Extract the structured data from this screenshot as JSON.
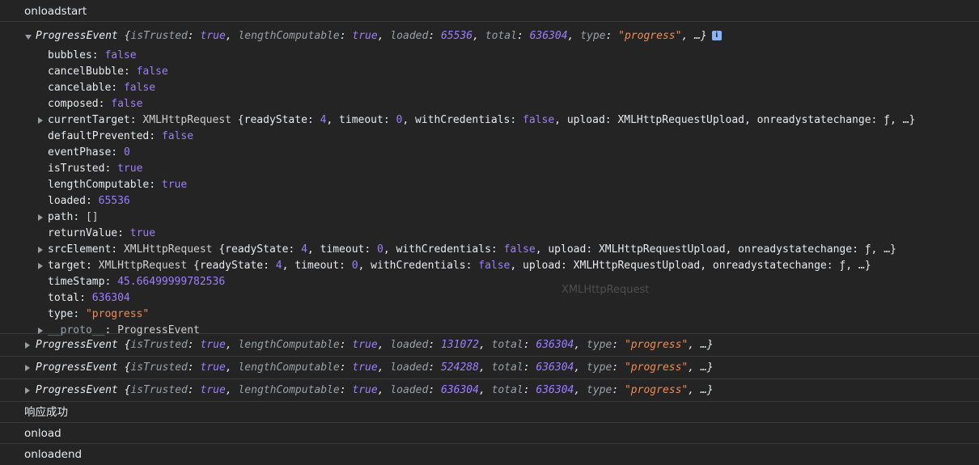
{
  "lines": {
    "onloadstart": "onloadstart",
    "success": "响应成功",
    "onload": "onload",
    "onloadend": "onloadend"
  },
  "expanded_event": {
    "class_name": "ProgressEvent",
    "loaded": "65536",
    "total": "636304",
    "type": "\"progress\"",
    "ellipsis": "…",
    "info_icon_label": "i"
  },
  "properties": [
    {
      "key": "bubbles",
      "value": "false",
      "kind": "b"
    },
    {
      "key": "cancelBubble",
      "value": "false",
      "kind": "b"
    },
    {
      "key": "cancelable",
      "value": "false",
      "kind": "b"
    },
    {
      "key": "composed",
      "value": "false",
      "kind": "b"
    },
    {
      "key": "currentTarget",
      "expandable": true,
      "obj": "XMLHttpRequest",
      "readyState": "4",
      "timeout": "0",
      "withCredentials": "false",
      "upload": "XMLHttpRequestUpload"
    },
    {
      "key": "defaultPrevented",
      "value": "false",
      "kind": "b"
    },
    {
      "key": "eventPhase",
      "value": "0",
      "kind": "n"
    },
    {
      "key": "isTrusted",
      "value": "true",
      "kind": "b"
    },
    {
      "key": "lengthComputable",
      "value": "true",
      "kind": "b"
    },
    {
      "key": "loaded",
      "value": "65536",
      "kind": "n"
    },
    {
      "key": "path",
      "value": "[]",
      "kind": "c",
      "expandable": true
    },
    {
      "key": "returnValue",
      "value": "true",
      "kind": "b"
    },
    {
      "key": "srcElement",
      "expandable": true,
      "obj": "XMLHttpRequest",
      "readyState": "4",
      "timeout": "0",
      "withCredentials": "false",
      "upload": "XMLHttpRequestUpload"
    },
    {
      "key": "target",
      "expandable": true,
      "obj": "XMLHttpRequest",
      "readyState": "4",
      "timeout": "0",
      "withCredentials": "false",
      "upload": "XMLHttpRequestUpload"
    },
    {
      "key": "timeStamp",
      "value": "45.66499999782536",
      "kind": "n"
    },
    {
      "key": "total",
      "value": "636304",
      "kind": "n"
    },
    {
      "key": "type",
      "value": "\"progress\"",
      "kind": "s"
    },
    {
      "key": "__proto__",
      "value": "ProgressEvent",
      "kind": "c",
      "expandable": true,
      "dim": true
    }
  ],
  "collapsed_events": [
    {
      "loaded": "131072",
      "total": "636304",
      "type": "\"progress\""
    },
    {
      "loaded": "524288",
      "total": "636304",
      "type": "\"progress\""
    },
    {
      "loaded": "636304",
      "total": "636304",
      "type": "\"progress\""
    }
  ],
  "tooltip_ghost": "XMLHttpRequest",
  "colors": {
    "background": "#242424",
    "boolean_number": "#9980ff",
    "string": "#f28b54",
    "info_badge": "#8ab4f8"
  }
}
